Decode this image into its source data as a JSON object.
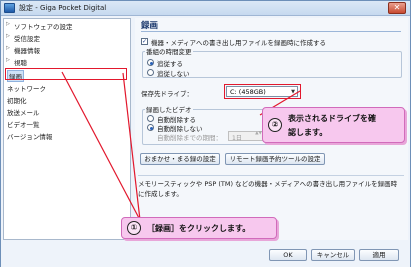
{
  "window": {
    "title": "設定 - Giga Pocket Digital",
    "close_glyph": "✕"
  },
  "sidebar": {
    "items": [
      {
        "label": "ソフトウェアの設定",
        "arrow": "▷"
      },
      {
        "label": "受信設定",
        "arrow": "▷"
      },
      {
        "label": "機器情報",
        "arrow": "▷"
      },
      {
        "label": "視聴",
        "arrow": "▷"
      },
      {
        "label": "録画",
        "arrow": ""
      },
      {
        "label": "ネットワーク",
        "arrow": ""
      },
      {
        "label": "初期化",
        "arrow": ""
      },
      {
        "label": "放送メール",
        "arrow": ""
      },
      {
        "label": "ビデオ一覧",
        "arrow": ""
      },
      {
        "label": "バージョン情報",
        "arrow": ""
      }
    ]
  },
  "main": {
    "section_title": "録画",
    "memory_checkbox": {
      "label": "機器・メディアへの書き出し用ファイルを録画時に作成する",
      "checked": true,
      "check_glyph": "✓"
    },
    "time_change_group": {
      "title": "番組の時間変更",
      "options": [
        {
          "label": "追従する",
          "selected": true
        },
        {
          "label": "追従しない",
          "selected": false
        }
      ]
    },
    "drive": {
      "label": "保存先ドライブ：",
      "value": "C: (458GB)",
      "dropdown_glyph": "▼"
    },
    "recorded_video_group": {
      "title": "録画したビデオ",
      "options": [
        {
          "label": "自動削除する",
          "selected": false
        },
        {
          "label": "自動削除しない",
          "selected": true
        }
      ],
      "period_label": "自動削除までの期間：",
      "period_value": "1日",
      "spin_glyphs": "▲▼"
    },
    "buttons": {
      "omakase": "おまかせ・まる録の設定",
      "remote": "リモート録画予約ツールの設定"
    },
    "description": "メモリースティックや PSP (TM) などの機器・メディアへの書き出し用ファイルを録画時に作成します。"
  },
  "footer": {
    "ok": "OK",
    "cancel": "キャンセル",
    "apply": "適用"
  },
  "callouts": {
    "one": {
      "num": "①",
      "text": "［録画］をクリックします。"
    },
    "two": {
      "num": "②",
      "text1": "表示されるドライブを確",
      "text2": "認します。"
    }
  },
  "colors": {
    "highlight": "#e2182d",
    "callout_bg": "#f7c8ee"
  }
}
